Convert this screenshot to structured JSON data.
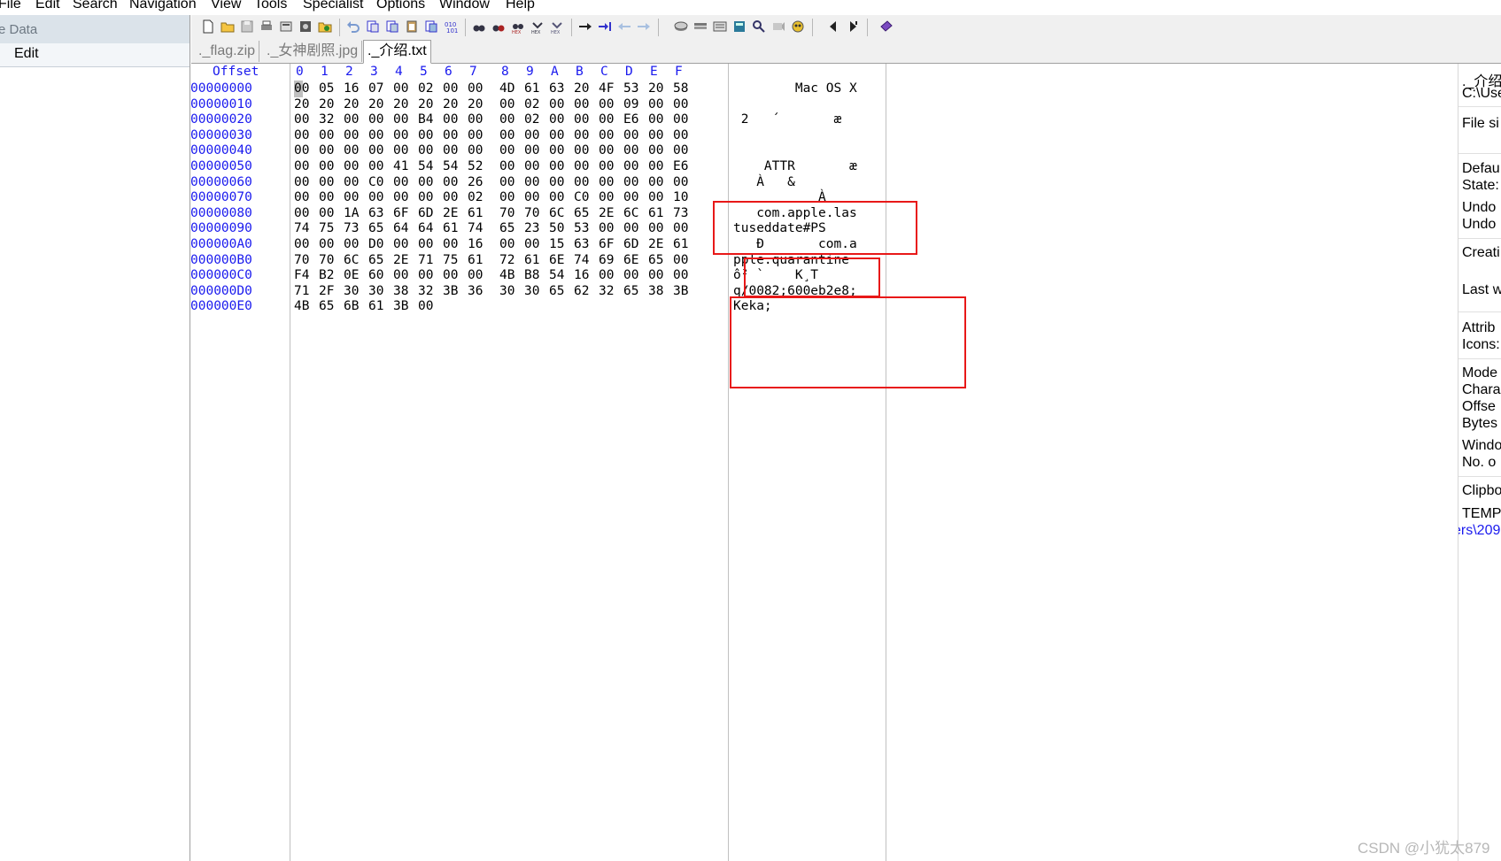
{
  "menu": [
    "File",
    "Edit",
    "Search",
    "Navigation",
    "View",
    "Tools",
    "Specialist",
    "Options",
    "Window",
    "Help"
  ],
  "left_pane": {
    "header": "e Data",
    "edit_label": "Edit"
  },
  "tabs": [
    {
      "label": "._flag.zip",
      "active": false
    },
    {
      "label": "._女神剧照.jpg",
      "active": false
    },
    {
      "label": "._介绍.txt",
      "active": true
    }
  ],
  "hex": {
    "offset_header": "Offset",
    "column_headers": [
      "0",
      "1",
      "2",
      "3",
      "4",
      "5",
      "6",
      "7",
      "8",
      "9",
      "A",
      "B",
      "C",
      "D",
      "E",
      "F"
    ],
    "rows": [
      {
        "offset": "00000000",
        "bytes": [
          "00",
          "05",
          "16",
          "07",
          "00",
          "02",
          "00",
          "00",
          "4D",
          "61",
          "63",
          "20",
          "4F",
          "53",
          "20",
          "58"
        ],
        "ascii": "        Mac OS X"
      },
      {
        "offset": "00000010",
        "bytes": [
          "20",
          "20",
          "20",
          "20",
          "20",
          "20",
          "20",
          "20",
          "00",
          "02",
          "00",
          "00",
          "00",
          "09",
          "00",
          "00"
        ],
        "ascii": ""
      },
      {
        "offset": "00000020",
        "bytes": [
          "00",
          "32",
          "00",
          "00",
          "00",
          "B4",
          "00",
          "00",
          "00",
          "02",
          "00",
          "00",
          "00",
          "E6",
          "00",
          "00"
        ],
        "ascii": " 2   ´       æ"
      },
      {
        "offset": "00000030",
        "bytes": [
          "00",
          "00",
          "00",
          "00",
          "00",
          "00",
          "00",
          "00",
          "00",
          "00",
          "00",
          "00",
          "00",
          "00",
          "00",
          "00"
        ],
        "ascii": ""
      },
      {
        "offset": "00000040",
        "bytes": [
          "00",
          "00",
          "00",
          "00",
          "00",
          "00",
          "00",
          "00",
          "00",
          "00",
          "00",
          "00",
          "00",
          "00",
          "00",
          "00"
        ],
        "ascii": ""
      },
      {
        "offset": "00000050",
        "bytes": [
          "00",
          "00",
          "00",
          "00",
          "41",
          "54",
          "54",
          "52",
          "00",
          "00",
          "00",
          "00",
          "00",
          "00",
          "00",
          "E6"
        ],
        "ascii": "    ATTR       æ"
      },
      {
        "offset": "00000060",
        "bytes": [
          "00",
          "00",
          "00",
          "C0",
          "00",
          "00",
          "00",
          "26",
          "00",
          "00",
          "00",
          "00",
          "00",
          "00",
          "00",
          "00"
        ],
        "ascii": "   À   &"
      },
      {
        "offset": "00000070",
        "bytes": [
          "00",
          "00",
          "00",
          "00",
          "00",
          "00",
          "00",
          "02",
          "00",
          "00",
          "00",
          "C0",
          "00",
          "00",
          "00",
          "10"
        ],
        "ascii": "           À"
      },
      {
        "offset": "00000080",
        "bytes": [
          "00",
          "00",
          "1A",
          "63",
          "6F",
          "6D",
          "2E",
          "61",
          "70",
          "70",
          "6C",
          "65",
          "2E",
          "6C",
          "61",
          "73"
        ],
        "ascii": "   com.apple.las"
      },
      {
        "offset": "00000090",
        "bytes": [
          "74",
          "75",
          "73",
          "65",
          "64",
          "64",
          "61",
          "74",
          "65",
          "23",
          "50",
          "53",
          "00",
          "00",
          "00",
          "00"
        ],
        "ascii": "tuseddate#PS"
      },
      {
        "offset": "000000A0",
        "bytes": [
          "00",
          "00",
          "00",
          "D0",
          "00",
          "00",
          "00",
          "16",
          "00",
          "00",
          "15",
          "63",
          "6F",
          "6D",
          "2E",
          "61"
        ],
        "ascii": "   Ð       com.a"
      },
      {
        "offset": "000000B0",
        "bytes": [
          "70",
          "70",
          "6C",
          "65",
          "2E",
          "71",
          "75",
          "61",
          "72",
          "61",
          "6E",
          "74",
          "69",
          "6E",
          "65",
          "00"
        ],
        "ascii": "pple.quarantine"
      },
      {
        "offset": "000000C0",
        "bytes": [
          "F4",
          "B2",
          "0E",
          "60",
          "00",
          "00",
          "00",
          "00",
          "4B",
          "B8",
          "54",
          "16",
          "00",
          "00",
          "00",
          "00"
        ],
        "ascii": "ô² `    K¸T"
      },
      {
        "offset": "000000D0",
        "bytes": [
          "71",
          "2F",
          "30",
          "30",
          "38",
          "32",
          "3B",
          "36",
          "30",
          "30",
          "65",
          "62",
          "32",
          "65",
          "38",
          "3B"
        ],
        "ascii": "q/0082;600eb2e8;"
      },
      {
        "offset": "000000E0",
        "bytes": [
          "4B",
          "65",
          "6B",
          "61",
          "3B",
          "00"
        ],
        "ascii": "Keka;"
      }
    ]
  },
  "info_panel": {
    "lines": [
      "._介绍",
      "C:\\Use",
      "File si",
      "Defau",
      "State:",
      "Undo",
      "Undo",
      "Creati",
      "Last w",
      "Attrib",
      "Icons:",
      "Mode",
      "Chara",
      "Offse",
      "Bytes",
      "Windo",
      "No. o",
      "Clipbo",
      "TEMP"
    ],
    "link": "ers\\209"
  },
  "watermark": "CSDN @小犹太879",
  "colors": {
    "offset_text": "#1a1aee",
    "annotation_red": "#e81818",
    "tab_inactive": "#7a7a7a"
  }
}
